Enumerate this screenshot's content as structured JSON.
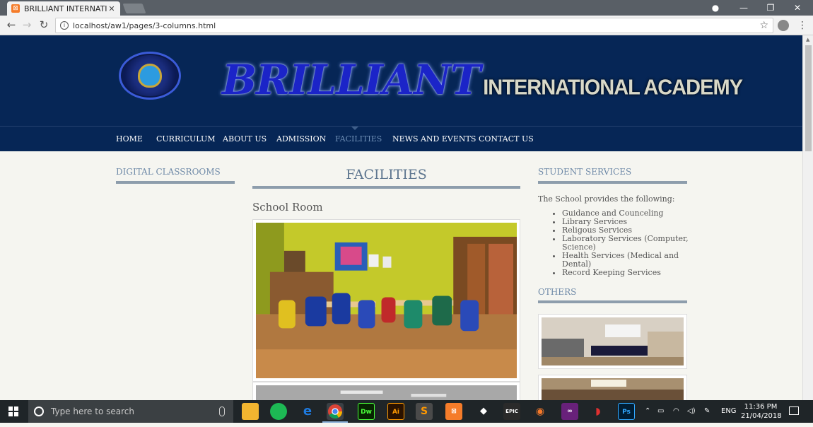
{
  "browser": {
    "tab_title": "BRILLIANT INTERNATION",
    "tab_close": "✕",
    "url": "localhost/aw1/pages/3-columns.html",
    "window_controls": {
      "user": "●",
      "minimize": "—",
      "maximize": "❐",
      "close": "✕"
    }
  },
  "site": {
    "brand_main": "BRILLIANT",
    "brand_sub": "INTERNATIONAL ACADEMY",
    "nav": [
      {
        "label": "HOME"
      },
      {
        "label": "CURRICULUM"
      },
      {
        "label": "ABOUT US"
      },
      {
        "label": "ADMISSION"
      },
      {
        "label": "FACILITIES",
        "active": true
      },
      {
        "label": "NEWS AND EVENTS"
      },
      {
        "label": "CONTACT US"
      }
    ],
    "left_heading": "DIGITAL CLASSROOMS",
    "page_title": "FACILITIES",
    "section_title": "School Room",
    "right_heading": "STUDENT SERVICES",
    "intro": "The School provides the following:",
    "services": [
      "Guidance and Counceling",
      "Library Services",
      "Religous Services",
      "Laboratory Services (Computer, Science)",
      "Health Services (Medical and Dental)",
      "Record Keeping Services"
    ],
    "others_heading": "OTHERS"
  },
  "taskbar": {
    "search_placeholder": "Type here to search",
    "apps": [
      "file-explorer",
      "spotify",
      "edge",
      "chrome",
      "dreamweaver",
      "illustrator",
      "sublime-text",
      "xampp",
      "unity",
      "epic-games",
      "blender",
      "visual-studio",
      "game-app",
      "photoshop"
    ],
    "app_labels": {
      "dreamweaver": "Dw",
      "illustrator": "Ai",
      "photoshop": "Ps",
      "epic-games": "EPIC"
    },
    "language": "ENG",
    "time": "11:36 PM",
    "date": "21/04/2018"
  },
  "colors": {
    "header_bg": "#062656",
    "accent_heading": "#6f8aa8",
    "active_nav": "#6f8fb6",
    "page_bg": "#f5f5f0"
  }
}
